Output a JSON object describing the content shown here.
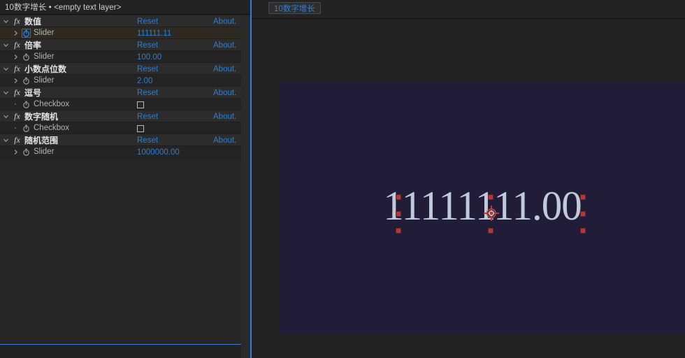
{
  "effect_controls": {
    "panel_title": "10数字增长 • <empty text layer>",
    "reset_label": "Reset",
    "about_label": "About.",
    "effects": [
      {
        "name": "数值",
        "badge": "fx",
        "expanded": true,
        "params": [
          {
            "type": "slider",
            "name": "Slider",
            "value": "111111.11",
            "selected": true,
            "keyframed": true,
            "has_twirl": true
          }
        ]
      },
      {
        "name": "倍率",
        "badge": "fx",
        "expanded": true,
        "params": [
          {
            "type": "slider",
            "name": "Slider",
            "value": "100.00",
            "selected": false,
            "keyframed": false,
            "has_twirl": true
          }
        ]
      },
      {
        "name": "小数点位数",
        "badge": "fx",
        "expanded": true,
        "params": [
          {
            "type": "slider",
            "name": "Slider",
            "value": "2.00",
            "selected": false,
            "keyframed": false,
            "has_twirl": true
          }
        ]
      },
      {
        "name": "逗号",
        "badge": "fx",
        "expanded": true,
        "params": [
          {
            "type": "checkbox",
            "name": "Checkbox",
            "checked": false,
            "selected": false,
            "keyframed": false,
            "has_twirl": false
          }
        ]
      },
      {
        "name": "数字随机",
        "badge": "fx",
        "expanded": true,
        "params": [
          {
            "type": "checkbox",
            "name": "Checkbox",
            "checked": false,
            "selected": false,
            "keyframed": false,
            "has_twirl": false
          }
        ]
      },
      {
        "name": "随机范围",
        "badge": "fx",
        "expanded": true,
        "params": [
          {
            "type": "slider",
            "name": "Slider",
            "value": "1000000.00",
            "selected": false,
            "keyframed": false,
            "has_twirl": true
          }
        ]
      }
    ]
  },
  "composition": {
    "tab_label": "10数字增长",
    "rendered_text": "11111111.00",
    "background_color": "#211C38",
    "text_color": "#bfcadb",
    "selection_handle_color": "#a83c3c"
  },
  "theme": {
    "panel_bg": "#232323",
    "list_bg": "#262626",
    "effect_row_bg": "#2c2c2c",
    "selected_row_bg": "#2f2a21",
    "link_blue": "#2b7fd4",
    "divider_blue": "#2f7fd8",
    "keyframe_icon_blue": "#2f8ff0"
  }
}
